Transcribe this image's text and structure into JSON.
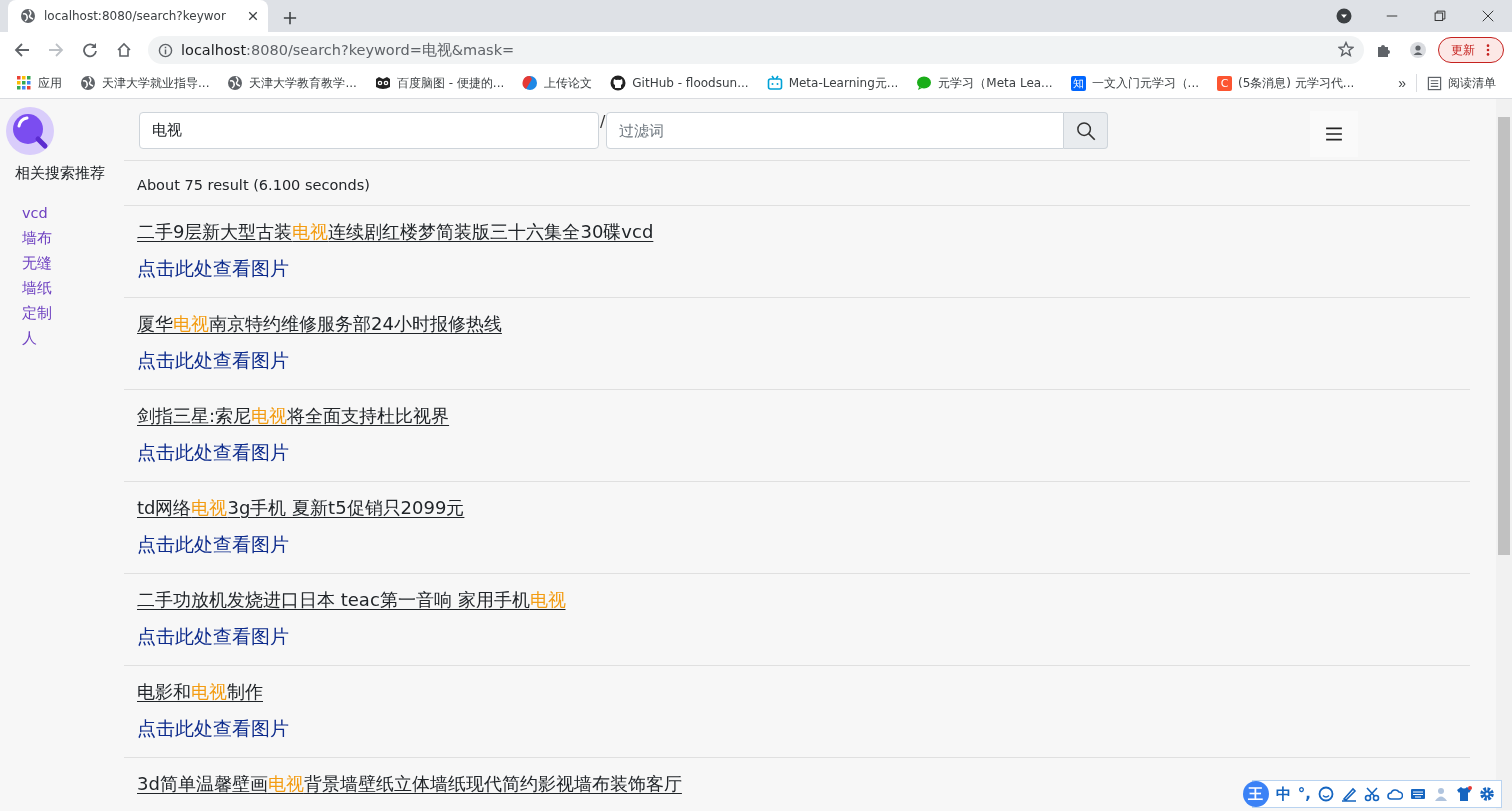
{
  "browser": {
    "tab": {
      "title": "localhost:8080/search?keywor",
      "selected": true
    },
    "address": {
      "host": "localhost",
      "rest": ":8080/search?keyword=电视&mask="
    },
    "update_button": "更新",
    "bookmarks": [
      {
        "label": "应用",
        "kind": "apps"
      },
      {
        "label": "天津大学就业指导...",
        "kind": "globe"
      },
      {
        "label": "天津大学教育教学...",
        "kind": "globe"
      },
      {
        "label": "百度脑图 - 便捷的...",
        "kind": "owl"
      },
      {
        "label": "上传论文",
        "kind": "ball"
      },
      {
        "label": "GitHub - floodsun...",
        "kind": "github"
      },
      {
        "label": "Meta-Learning元...",
        "kind": "tv"
      },
      {
        "label": "元学习（Meta Lea...",
        "kind": "chat"
      },
      {
        "label": "一文入门元学习（...",
        "kind": "badge",
        "badge": "知",
        "color": "#0066ff"
      },
      {
        "label": "(5条消息) 元学习代...",
        "kind": "badge",
        "badge": "C",
        "color": "#fc5531"
      }
    ],
    "more": "»",
    "reading_list": "阅读清单"
  },
  "page": {
    "search": {
      "value": "电视"
    },
    "separator": "/",
    "filter": {
      "placeholder": "过滤词"
    },
    "related": {
      "title": "相关搜索推荐",
      "items": [
        "vcd",
        "墙布",
        "无缝",
        "墙纸",
        "定制",
        "人"
      ]
    },
    "summary": "About 75 result (6.100 seconds)",
    "results": [
      {
        "title_parts": [
          {
            "text": "二手9层新大型古装",
            "highlight": false
          },
          {
            "text": "电视",
            "highlight": true
          },
          {
            "text": "连续剧红楼梦简装版三十六集全30碟vcd",
            "highlight": false
          }
        ],
        "link": "点击此处查看图片"
      },
      {
        "title_parts": [
          {
            "text": "厦华",
            "highlight": false
          },
          {
            "text": "电视",
            "highlight": true
          },
          {
            "text": "南京特约维修服务部24小时报修热线",
            "highlight": false
          }
        ],
        "link": "点击此处查看图片"
      },
      {
        "title_parts": [
          {
            "text": "剑指三星:索尼",
            "highlight": false
          },
          {
            "text": "电视",
            "highlight": true
          },
          {
            "text": "将全面支持杜比视界",
            "highlight": false
          }
        ],
        "link": "点击此处查看图片"
      },
      {
        "title_parts": [
          {
            "text": "td网络",
            "highlight": false
          },
          {
            "text": "电视",
            "highlight": true
          },
          {
            "text": "3g手机 夏新t5促销只2099元",
            "highlight": false
          }
        ],
        "link": "点击此处查看图片"
      },
      {
        "title_parts": [
          {
            "text": "二手功放机发烧进口日本 teac第一音响 家用手机",
            "highlight": false
          },
          {
            "text": "电视",
            "highlight": true
          }
        ],
        "link": "点击此处查看图片"
      },
      {
        "title_parts": [
          {
            "text": "电影和",
            "highlight": false
          },
          {
            "text": "电视",
            "highlight": true
          },
          {
            "text": "制作",
            "highlight": false
          }
        ],
        "link": "点击此处查看图片"
      },
      {
        "title_parts": [
          {
            "text": "3d简单温馨壁画",
            "highlight": false
          },
          {
            "text": "电视",
            "highlight": true
          },
          {
            "text": "背景墙壁纸立体墙纸现代简约影视墙布装饰客厅",
            "highlight": false
          }
        ]
      }
    ]
  },
  "ime": {
    "logo": "王",
    "mode": "中",
    "punct": "°,"
  }
}
